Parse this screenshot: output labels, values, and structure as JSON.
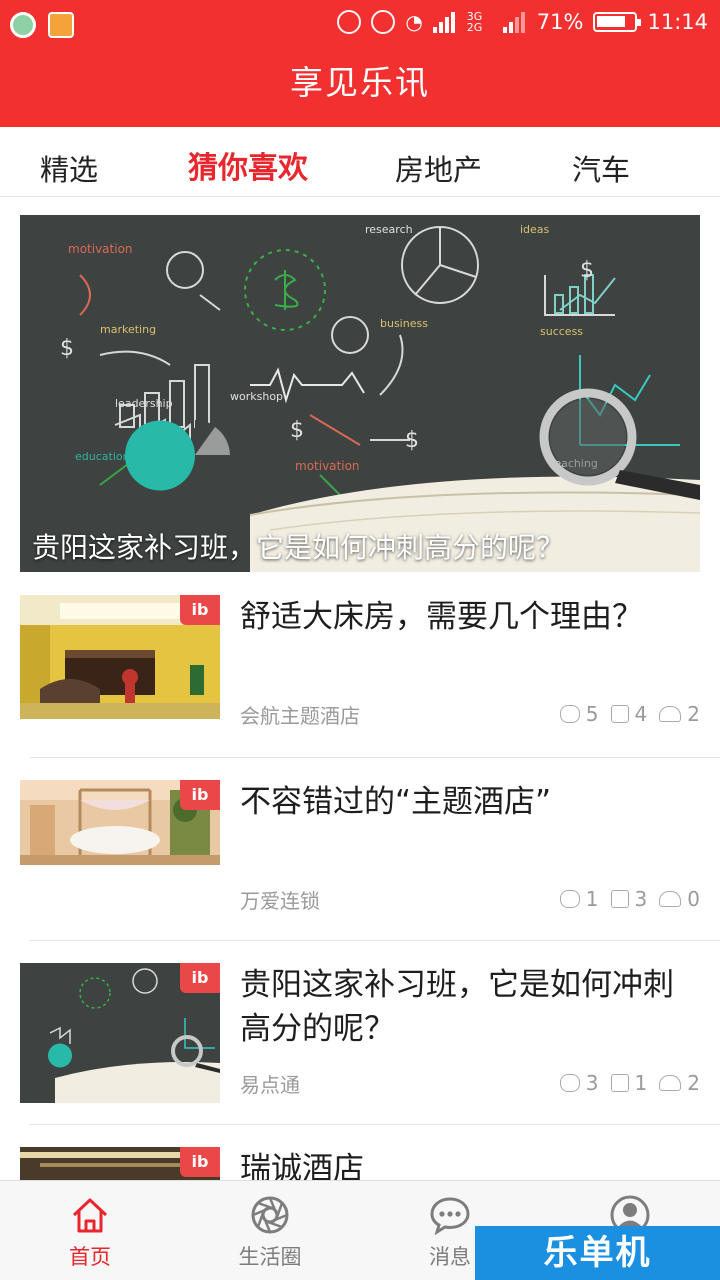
{
  "status_bar": {
    "battery": "71%",
    "time": "11:14",
    "network": "3G 2G"
  },
  "app": {
    "title": "享见乐讯",
    "accent": "#f23030",
    "active_tab_color": "#e8262d"
  },
  "tabs": [
    {
      "label": "精选",
      "active": false
    },
    {
      "label": "猜你喜欢",
      "active": true
    },
    {
      "label": "房地产",
      "active": false
    },
    {
      "label": "汽车",
      "active": false
    }
  ],
  "banner": {
    "title": "贵阳这家补习班，它是如何冲刺高分的呢？",
    "chalk_words": [
      "motivation",
      "research",
      "business",
      "marketing",
      "leadership",
      "workshop",
      "success",
      "education",
      "teaching",
      "ideas"
    ]
  },
  "articles": [
    {
      "title": "舒适大床房，需要几个理由？",
      "source": "会航主题酒店",
      "comments": "5",
      "likes": "4",
      "shares": "2",
      "thumb_tag": "ib"
    },
    {
      "title": "不容错过的“主题酒店”",
      "source": "万爱连锁",
      "comments": "1",
      "likes": "3",
      "shares": "0",
      "thumb_tag": "ib"
    },
    {
      "title": "贵阳这家补习班，它是如何冲刺高分的呢？",
      "source": "易点通",
      "comments": "3",
      "likes": "1",
      "shares": "2",
      "thumb_tag": "ib"
    },
    {
      "title": "瑞诚酒店",
      "thumb_tag": "ib"
    }
  ],
  "bottom_nav": [
    {
      "label": "首页",
      "icon": "home-icon",
      "active": true
    },
    {
      "label": "生活圈",
      "icon": "aperture-icon",
      "active": false
    },
    {
      "label": "消息",
      "icon": "message-icon",
      "active": false
    },
    {
      "label": "",
      "icon": "profile-icon",
      "active": false
    }
  ],
  "watermark": "乐单机"
}
